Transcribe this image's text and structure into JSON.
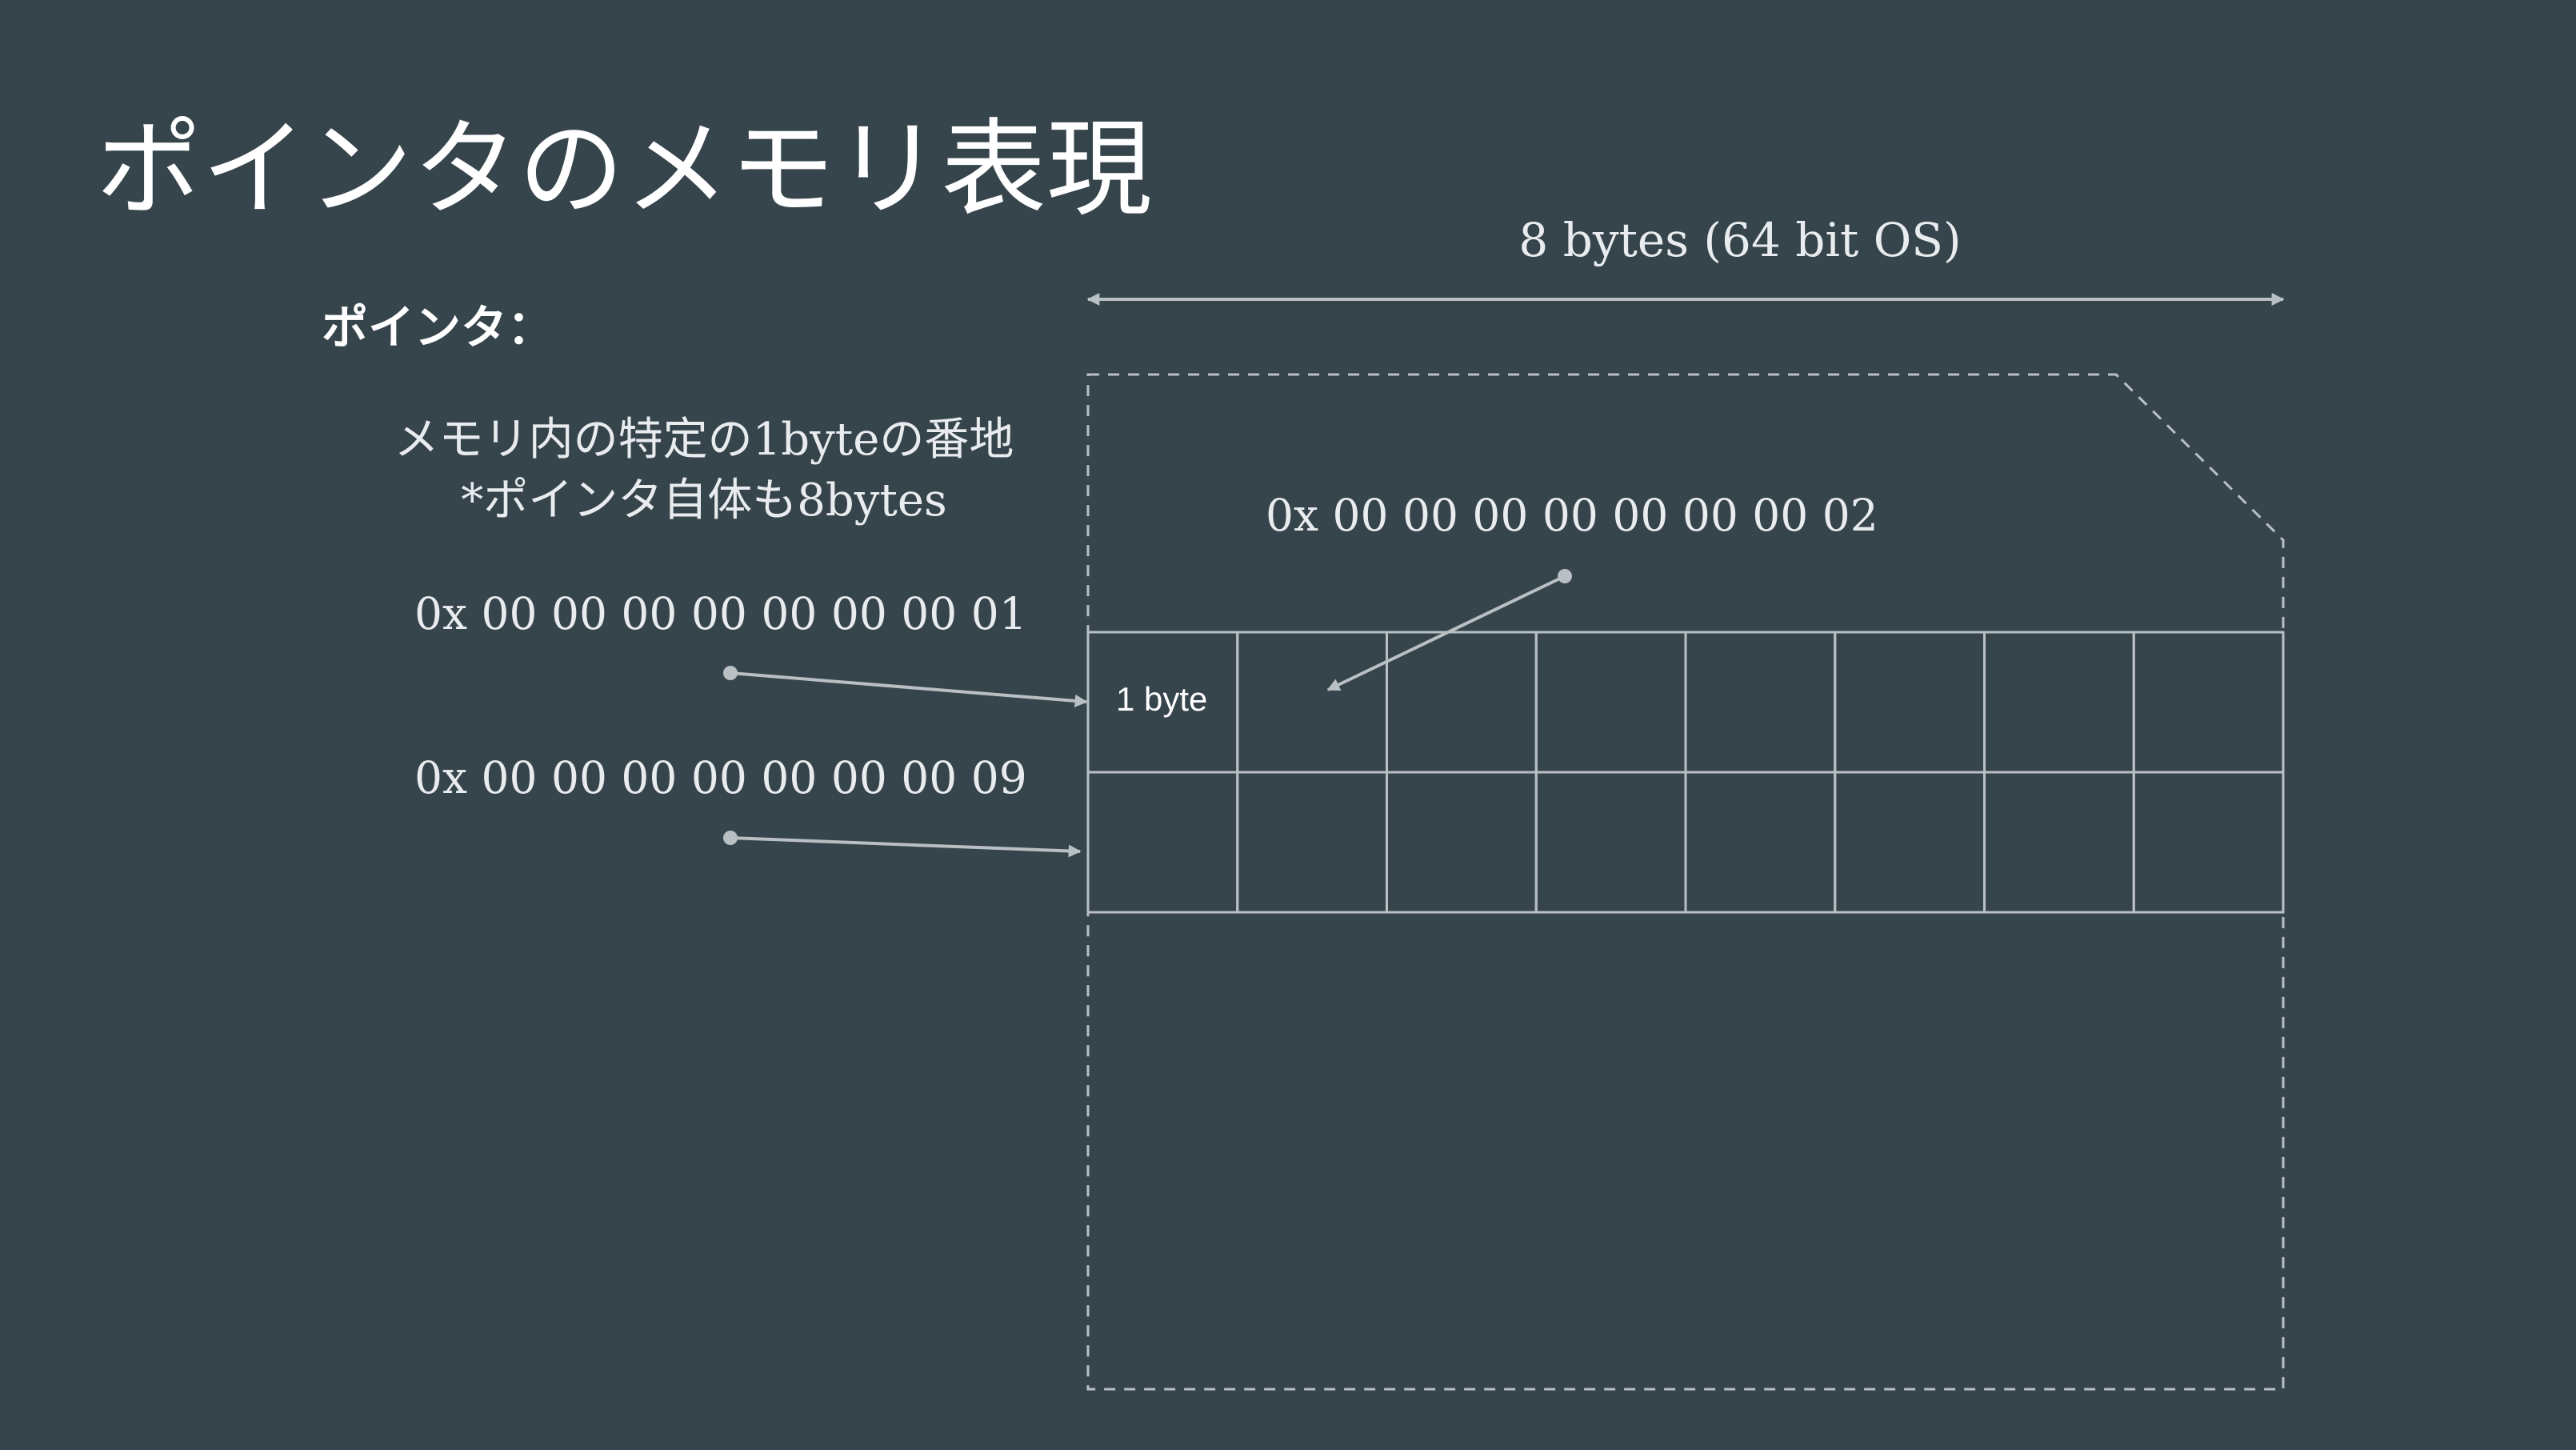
{
  "slide": {
    "title": "ポインタのメモリ表現",
    "pointer_heading": "ポインタ：",
    "description": [
      "メモリ内の特定の1byteの番地",
      "*ポインタ自体も8bytes"
    ]
  },
  "diagram": {
    "width_label": "8 bytes (64 bit OS)",
    "cell_label": "1 byte",
    "addresses": [
      {
        "label": "0x 00 00 00 00 00 00 00 01",
        "points_to_cell": 1
      },
      {
        "label": "0x 00 00 00 00 00 00 00 09",
        "points_to_cell": 9
      },
      {
        "label": "0x 00 00 00 00 00 00 00 02",
        "points_to_cell": 2
      }
    ],
    "grid": {
      "columns": 8,
      "rows": 2
    }
  },
  "colors": {
    "background": "#36444c",
    "text": "#e9ecee",
    "lines": "#b9c0c4"
  }
}
